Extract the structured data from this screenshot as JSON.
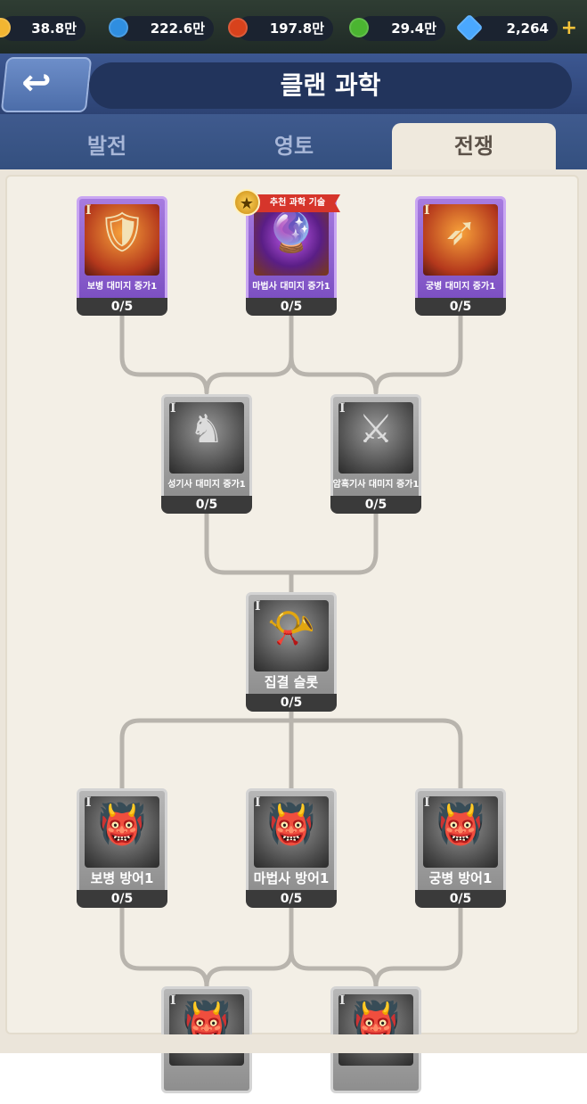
{
  "resources": [
    {
      "icon": "gold-coin-icon",
      "value": "38.8만",
      "color": "#f2b531"
    },
    {
      "icon": "blue-orb-icon",
      "value": "222.6만",
      "color": "#2f8ee0"
    },
    {
      "icon": "red-orb-icon",
      "value": "197.8만",
      "color": "#d8421c"
    },
    {
      "icon": "green-orb-icon",
      "value": "29.4만",
      "color": "#4bb531"
    },
    {
      "icon": "blue-gem-icon",
      "value": "2,264",
      "color": "#4aa8ff"
    }
  ],
  "header": {
    "title": "클랜 과학"
  },
  "tabs": [
    {
      "label": "발전",
      "active": false
    },
    {
      "label": "영토",
      "active": false
    },
    {
      "label": "전쟁",
      "active": true
    }
  ],
  "badge": {
    "label": "추천 과학 기술"
  },
  "cards": [
    {
      "label": "보병 대미지 증가1",
      "count": "0/5",
      "tier": "I"
    },
    {
      "label": "마법사 대미지 증가1",
      "count": "0/5",
      "tier": "I"
    },
    {
      "label": "궁병 대미지 증가1",
      "count": "0/5",
      "tier": "I"
    },
    {
      "label": "성기사 대미지 증가1",
      "count": "0/5",
      "tier": "I"
    },
    {
      "label": "암흑기사 대미지 증가1",
      "count": "0/5",
      "tier": "I"
    },
    {
      "label": "집결 슬롯",
      "count": "0/5",
      "tier": "I"
    },
    {
      "label": "보병 방어1",
      "count": "0/5",
      "tier": "I"
    },
    {
      "label": "마법사 방어1",
      "count": "0/5",
      "tier": "I"
    },
    {
      "label": "궁병 방어1",
      "count": "0/5",
      "tier": "I"
    },
    {
      "label": "",
      "count": "",
      "tier": "I"
    },
    {
      "label": "",
      "count": "",
      "tier": "I"
    }
  ]
}
